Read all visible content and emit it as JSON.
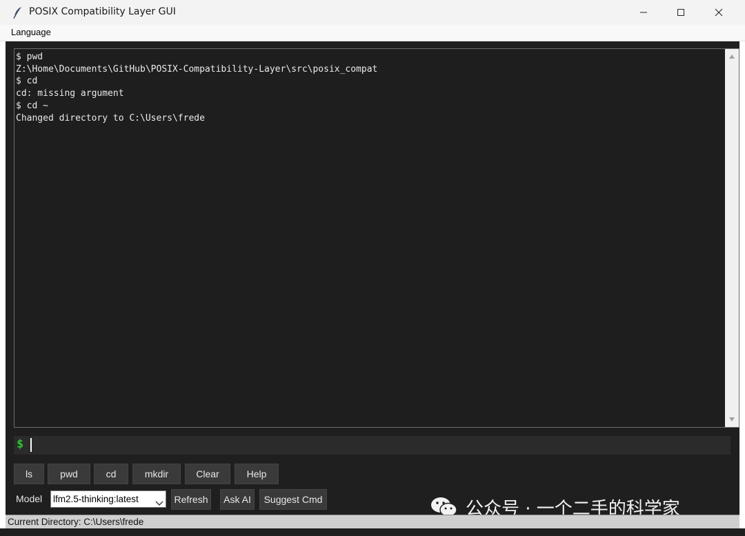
{
  "window": {
    "title": "POSIX Compatibility Layer GUI",
    "icon": "feather-icon"
  },
  "menu": {
    "items": [
      "Language"
    ]
  },
  "terminal": {
    "lines": [
      "$ pwd",
      "Z:\\Home\\Documents\\GitHub\\POSIX-Compatibility-Layer\\src\\posix_compat",
      "$ cd",
      "cd: missing argument",
      "$ cd ~",
      "Changed directory to C:\\Users\\frede"
    ]
  },
  "input": {
    "prompt": "$",
    "value": ""
  },
  "buttons": {
    "ls": "ls",
    "pwd": "pwd",
    "cd": "cd",
    "mkdir": "mkdir",
    "clear": "Clear",
    "help": "Help"
  },
  "model": {
    "label": "Model",
    "selected": "lfm2.5-thinking:latest",
    "refresh": "Refresh",
    "ask_ai": "Ask AI",
    "suggest": "Suggest Cmd"
  },
  "watermark": {
    "text": "公众号 · 一个二手的科学家"
  },
  "status": {
    "text": "Current Directory: C:\\Users\\frede"
  },
  "colors": {
    "background": "#1f1f1f",
    "terminal_text": "#eaeaea",
    "prompt": "#2ec32e",
    "button": "#3a3a3a"
  }
}
